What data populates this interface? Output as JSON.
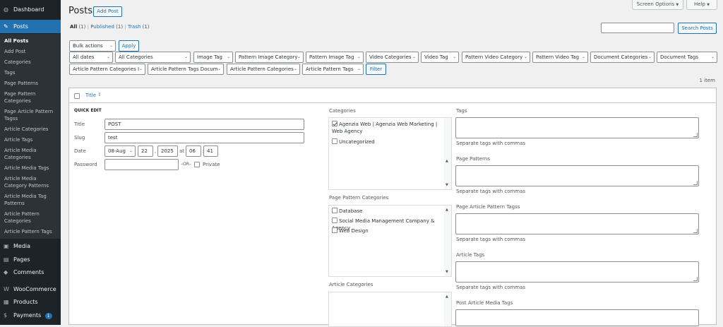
{
  "sidebar": {
    "top_items": [
      {
        "label": "Dashboard",
        "icon": "dashboard-icon"
      },
      {
        "label": "Posts",
        "icon": "pin-icon"
      }
    ],
    "submenu": [
      "All Posts",
      "Add Post",
      "Categories",
      "Tags",
      "Page Patterns",
      "Page Pattern Categories",
      "Page Article Pattern Tagss",
      "Article Categories",
      "Article Tags",
      "Article Media Categories",
      "Article Media Tags",
      "Article Media Category Patterns",
      "Article Media Tag Patterns",
      "Article Pattern Categories",
      "Article Pattern Tags"
    ],
    "bottom_items": [
      {
        "label": "Media",
        "icon": "media-icon"
      },
      {
        "label": "Pages",
        "icon": "pages-icon"
      },
      {
        "label": "Comments",
        "icon": "comments-icon"
      },
      {
        "label": "WooCommerce",
        "icon": "woocommerce-icon"
      },
      {
        "label": "Products",
        "icon": "products-icon"
      },
      {
        "label": "Payments",
        "icon": "payments-icon",
        "badge": "1"
      }
    ]
  },
  "header": {
    "title": "Posts",
    "add_post": "Add Post",
    "screen_options": "Screen Options",
    "help": "Help"
  },
  "views": {
    "all": "All",
    "all_count": "(1)",
    "published": "Published",
    "published_count": "(1)",
    "trash": "Trash",
    "trash_count": "(1)"
  },
  "search": {
    "value": "",
    "button": "Search Posts"
  },
  "bulk": {
    "select": "Bulk actions",
    "apply": "Apply"
  },
  "filters": [
    "All dates",
    "All Categories",
    "Image Tag",
    "Pattern Image Category",
    "Pattern Image Tag",
    "Video Categories",
    "Video Tag",
    "Pattern Video Category",
    "Pattern Video Tag",
    "Document Categories",
    "Document Tags",
    "Article Pattern Categories I",
    "Article Pattern Tags Docum",
    "Article Pattern Categories",
    "Article Pattern Tags"
  ],
  "filter_button": "Filter",
  "items_count": "1 item",
  "table": {
    "title_header": "Title",
    "sort_icon": "sort-icon"
  },
  "quick_edit": {
    "heading": "QUICK EDIT",
    "title_label": "Title",
    "title_value": "POST",
    "slug_label": "Slug",
    "slug_value": "test",
    "date_label": "Date",
    "month": "08-Aug",
    "day": "22",
    "year": "2025",
    "at": "at",
    "hour": "06",
    "minute": "41",
    "password_label": "Password",
    "password_value": "",
    "or": "–OR–",
    "private_label": "Private"
  },
  "categories": {
    "label": "Categories",
    "items": [
      {
        "label": "Agenzia Web | Agenzia Web Marketing | Web Agency",
        "checked": true
      },
      {
        "label": "Uncategorized",
        "checked": false
      }
    ]
  },
  "page_pattern_categories": {
    "label": "Page Pattern Categories",
    "items": [
      {
        "label": "Database",
        "checked": false
      },
      {
        "label": "Social Media Management Company & Agency",
        "checked": false
      },
      {
        "label": "Web Design",
        "checked": false
      }
    ]
  },
  "article_categories": {
    "label": "Article Categories"
  },
  "taxonomies": [
    {
      "label": "Tags",
      "hint": "Separate tags with commas"
    },
    {
      "label": "Page Patterns",
      "hint": "Separate tags with commas"
    },
    {
      "label": "Page Article Pattern Tagss",
      "hint": "Separate tags with commas"
    },
    {
      "label": "Article Tags",
      "hint": "Separate tags with commas"
    },
    {
      "label": "Post Article Media Tags",
      "hint": ""
    }
  ]
}
